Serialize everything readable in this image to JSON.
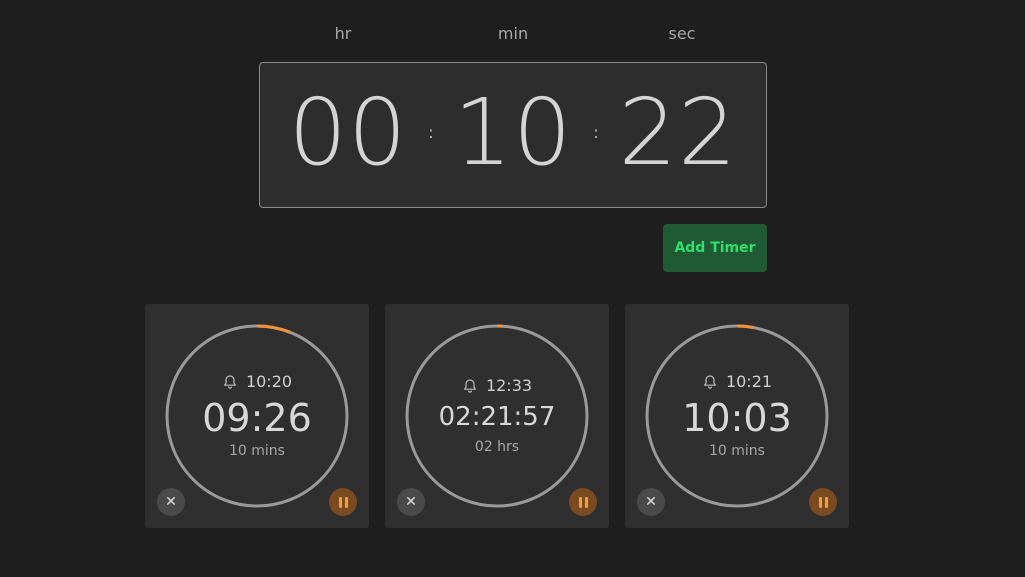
{
  "labels": {
    "hr": "hr",
    "min": "min",
    "sec": "sec"
  },
  "entry": {
    "hours": "00",
    "minutes": "10",
    "seconds": "22",
    "separator": ":"
  },
  "add_button": "Add Timer",
  "colors": {
    "accent": "#f0923a",
    "ring": "#9a9a9a",
    "add_bg": "#1f5a34",
    "add_text": "#2ee06a"
  },
  "timers": [
    {
      "alarm_time": "10:20",
      "remaining": "09:26",
      "duration": "10 mins",
      "progress": 0.06
    },
    {
      "alarm_time": "12:33",
      "remaining": "02:21:57",
      "duration": "02 hrs",
      "progress": 0.01
    },
    {
      "alarm_time": "10:21",
      "remaining": "10:03",
      "duration": "10 mins",
      "progress": 0.03
    }
  ],
  "icons": {
    "alarm": "bell-icon",
    "close": "close-icon",
    "pause": "pause-icon"
  }
}
